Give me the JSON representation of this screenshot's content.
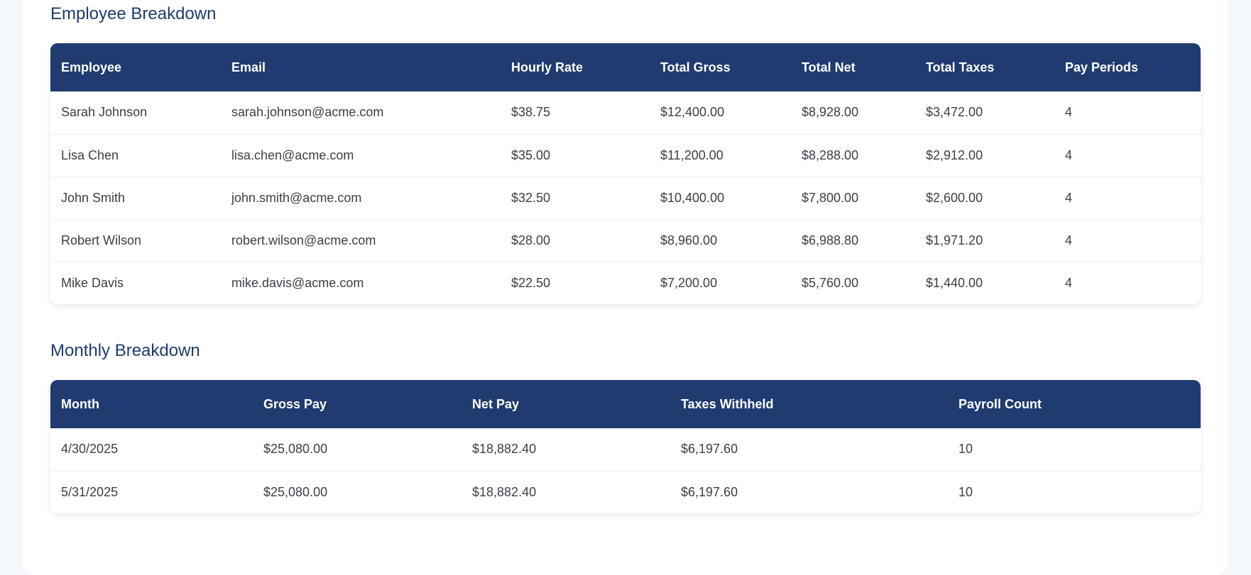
{
  "employee_section": {
    "title": "Employee Breakdown",
    "columns": [
      "Employee",
      "Email",
      "Hourly Rate",
      "Total Gross",
      "Total Net",
      "Total Taxes",
      "Pay Periods"
    ],
    "rows": [
      [
        "Sarah Johnson",
        "sarah.johnson@acme.com",
        "$38.75",
        "$12,400.00",
        "$8,928.00",
        "$3,472.00",
        "4"
      ],
      [
        "Lisa Chen",
        "lisa.chen@acme.com",
        "$35.00",
        "$11,200.00",
        "$8,288.00",
        "$2,912.00",
        "4"
      ],
      [
        "John Smith",
        "john.smith@acme.com",
        "$32.50",
        "$10,400.00",
        "$7,800.00",
        "$2,600.00",
        "4"
      ],
      [
        "Robert Wilson",
        "robert.wilson@acme.com",
        "$28.00",
        "$8,960.00",
        "$6,988.80",
        "$1,971.20",
        "4"
      ],
      [
        "Mike Davis",
        "mike.davis@acme.com",
        "$22.50",
        "$7,200.00",
        "$5,760.00",
        "$1,440.00",
        "4"
      ]
    ]
  },
  "monthly_section": {
    "title": "Monthly Breakdown",
    "columns": [
      "Month",
      "Gross Pay",
      "Net Pay",
      "Taxes Withheld",
      "Payroll Count"
    ],
    "rows": [
      [
        "4/30/2025",
        "$25,080.00",
        "$18,882.40",
        "$6,197.60",
        "10"
      ],
      [
        "5/31/2025",
        "$25,080.00",
        "$18,882.40",
        "$6,197.60",
        "10"
      ]
    ]
  },
  "colors": {
    "header_bg": "#1f3b70",
    "title_text": "#1f3b70",
    "page_bg": "#f4f7fb"
  }
}
